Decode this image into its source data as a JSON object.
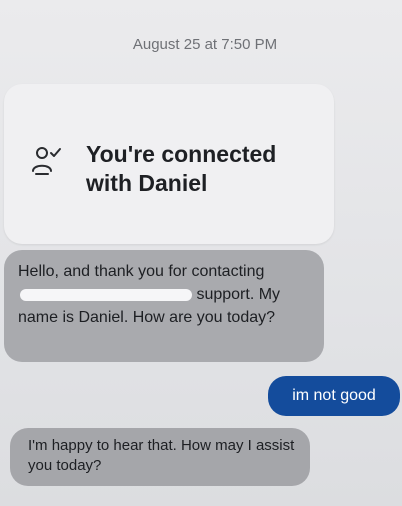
{
  "chat": {
    "timestamp": "August 25 at 7:50 PM",
    "connected_notice": "You're connected with Daniel",
    "agent_icon": "person-check-icon",
    "messages": [
      {
        "sender": "agent",
        "text_before_redaction": "Hello, and thank you for contacting",
        "text_after_redaction": "support. My name is Daniel. How are you today?"
      },
      {
        "sender": "user",
        "text": "im not good"
      },
      {
        "sender": "agent",
        "text": "I'm happy to hear that. How may I assist you today?"
      }
    ]
  },
  "colors": {
    "user_bubble": "#144c9c",
    "agent_bubble": "#a9aaae",
    "card_background": "#f0f0f2",
    "page_background": "#e6e7ea"
  }
}
